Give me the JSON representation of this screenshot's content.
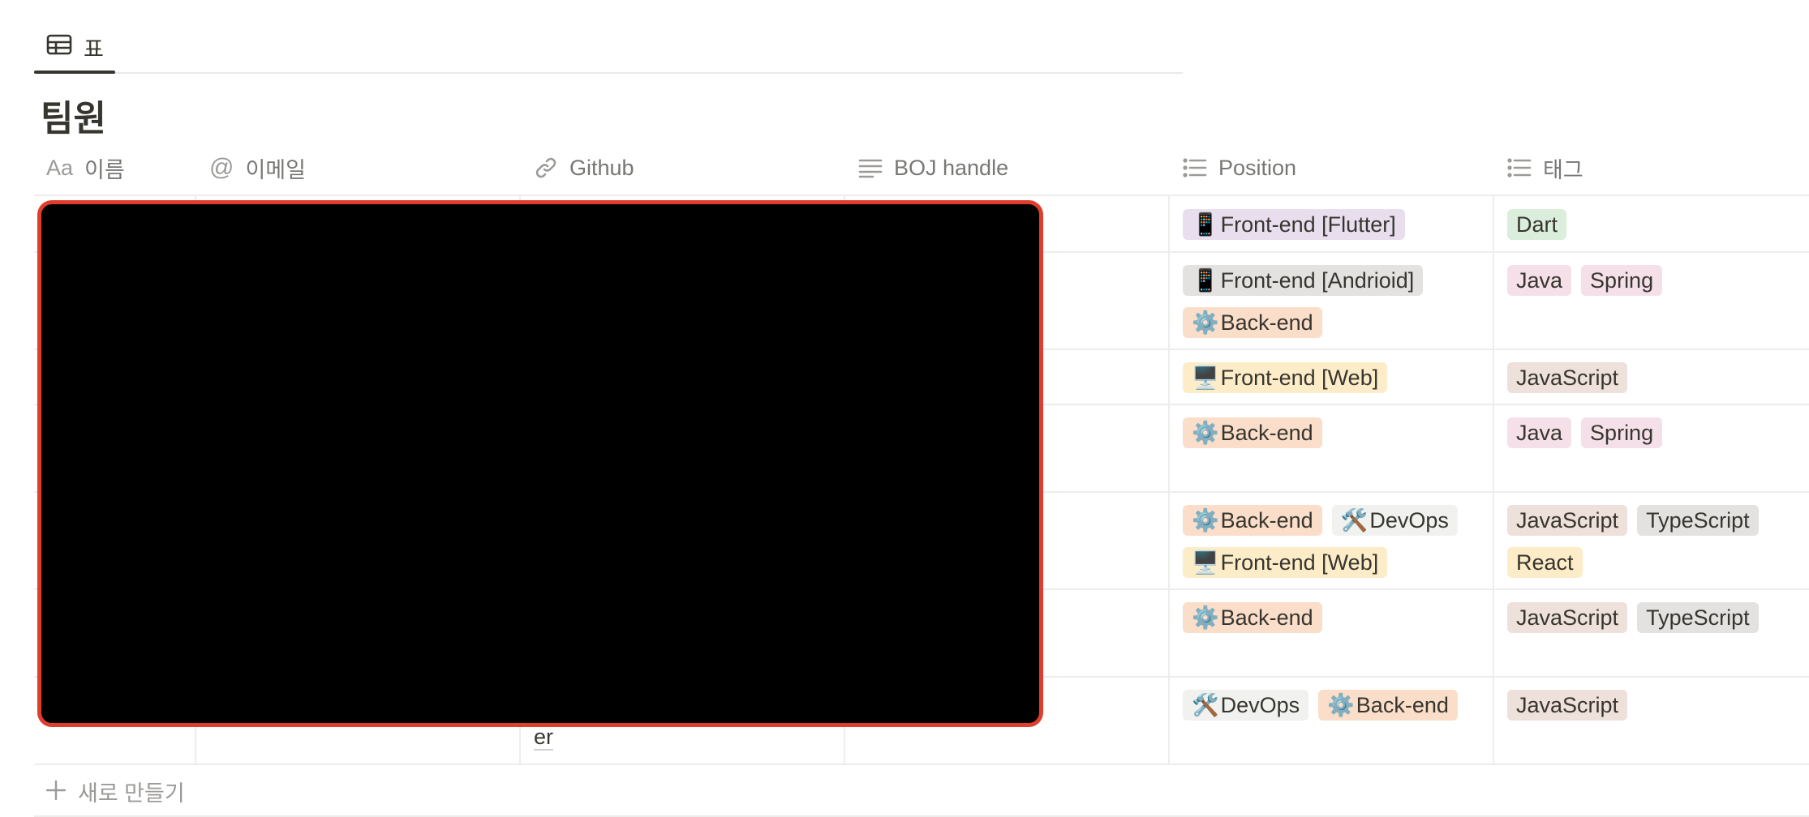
{
  "view": {
    "tab_label": "표"
  },
  "database": {
    "title": "팀원"
  },
  "columns": [
    {
      "icon": "text-icon",
      "icon_text": "Aa",
      "label": "이름"
    },
    {
      "icon": "at-icon",
      "icon_text": "@",
      "label": "이메일"
    },
    {
      "icon": "link-icon",
      "label": "Github"
    },
    {
      "icon": "text-lines-icon",
      "label": "BOJ handle"
    },
    {
      "icon": "list-icon",
      "label": "Position"
    },
    {
      "icon": "list-icon",
      "label": "태그"
    }
  ],
  "rows": [
    {
      "position": [
        {
          "emoji": "📱",
          "text": "Front-end [Flutter]",
          "color": "#e8deee"
        }
      ],
      "tags": [
        {
          "text": "Dart",
          "color": "#dbeddb"
        }
      ]
    },
    {
      "position": [
        {
          "emoji": "📱",
          "text": "Front-end [Andrioid]",
          "color": "#e3e2e0"
        },
        {
          "emoji": "⚙️",
          "text": "Back-end",
          "color": "#fadec9"
        }
      ],
      "tags": [
        {
          "text": "Java",
          "color": "#f5e0e9"
        },
        {
          "text": "Spring",
          "color": "#f5e0e9"
        }
      ]
    },
    {
      "position": [
        {
          "emoji": "🖥️",
          "text": "Front-end [Web]",
          "color": "#fdecc8"
        }
      ],
      "tags": [
        {
          "text": "JavaScript",
          "color": "#eee0da"
        }
      ]
    },
    {
      "position": [
        {
          "emoji": "⚙️",
          "text": "Back-end",
          "color": "#fadec9"
        }
      ],
      "tags": [
        {
          "text": "Java",
          "color": "#f5e0e9"
        },
        {
          "text": "Spring",
          "color": "#f5e0e9"
        }
      ]
    },
    {
      "position": [
        {
          "emoji": "⚙️",
          "text": "Back-end",
          "color": "#fadec9"
        },
        {
          "emoji": "🛠️",
          "text": "DevOps",
          "color": "#f1f1ef"
        },
        {
          "emoji": "🖥️",
          "text": "Front-end [Web]",
          "color": "#fdecc8"
        }
      ],
      "tags": [
        {
          "text": "JavaScript",
          "color": "#eee0da"
        },
        {
          "text": "TypeScript",
          "color": "#e3e2e0"
        },
        {
          "text": "React",
          "color": "#fdecc8"
        }
      ]
    },
    {
      "position": [
        {
          "emoji": "⚙️",
          "text": "Back-end",
          "color": "#fadec9"
        }
      ],
      "tags": [
        {
          "text": "JavaScript",
          "color": "#eee0da"
        },
        {
          "text": "TypeScript",
          "color": "#e3e2e0"
        }
      ]
    },
    {
      "position": [
        {
          "emoji": "🛠️",
          "text": "DevOps",
          "color": "#f1f1ef"
        },
        {
          "emoji": "⚙️",
          "text": "Back-end",
          "color": "#fadec9"
        }
      ],
      "tags": [
        {
          "text": "JavaScript",
          "color": "#eee0da"
        }
      ]
    }
  ],
  "partial_cell_text": "er",
  "new_row_label": "새로 만들기"
}
